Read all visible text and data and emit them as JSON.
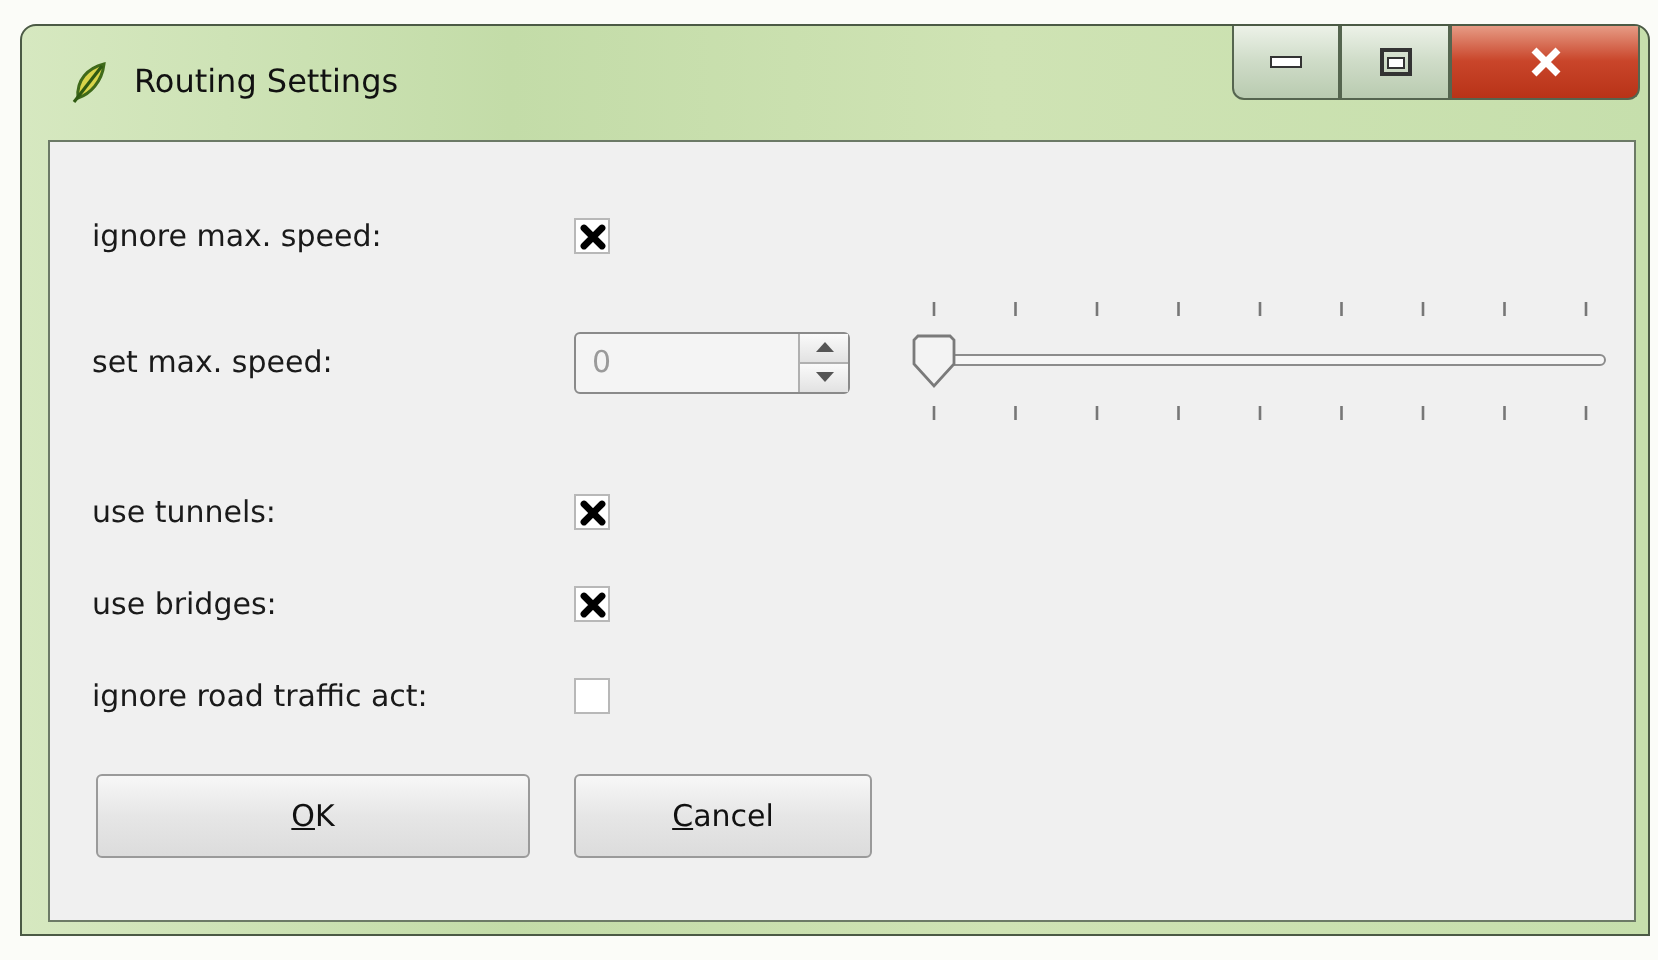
{
  "window": {
    "title": "Routing Settings"
  },
  "rows": [
    {
      "kind": "checkbox",
      "label": "ignore max. speed:",
      "checked": true
    },
    {
      "kind": "spin-slider",
      "label": "set max. speed:",
      "value": "0",
      "disabled": true,
      "level": 0
    },
    {
      "kind": "checkbox",
      "label": "use tunnels:",
      "checked": true
    },
    {
      "kind": "checkbox",
      "label": "use bridges:",
      "checked": true
    },
    {
      "kind": "checkbox",
      "label": "ignore road traffic act:",
      "checked": false
    }
  ],
  "buttons": [
    {
      "mnemonic": "O",
      "rest": "K"
    },
    {
      "mnemonic": "C",
      "rest": "ancel"
    }
  ]
}
